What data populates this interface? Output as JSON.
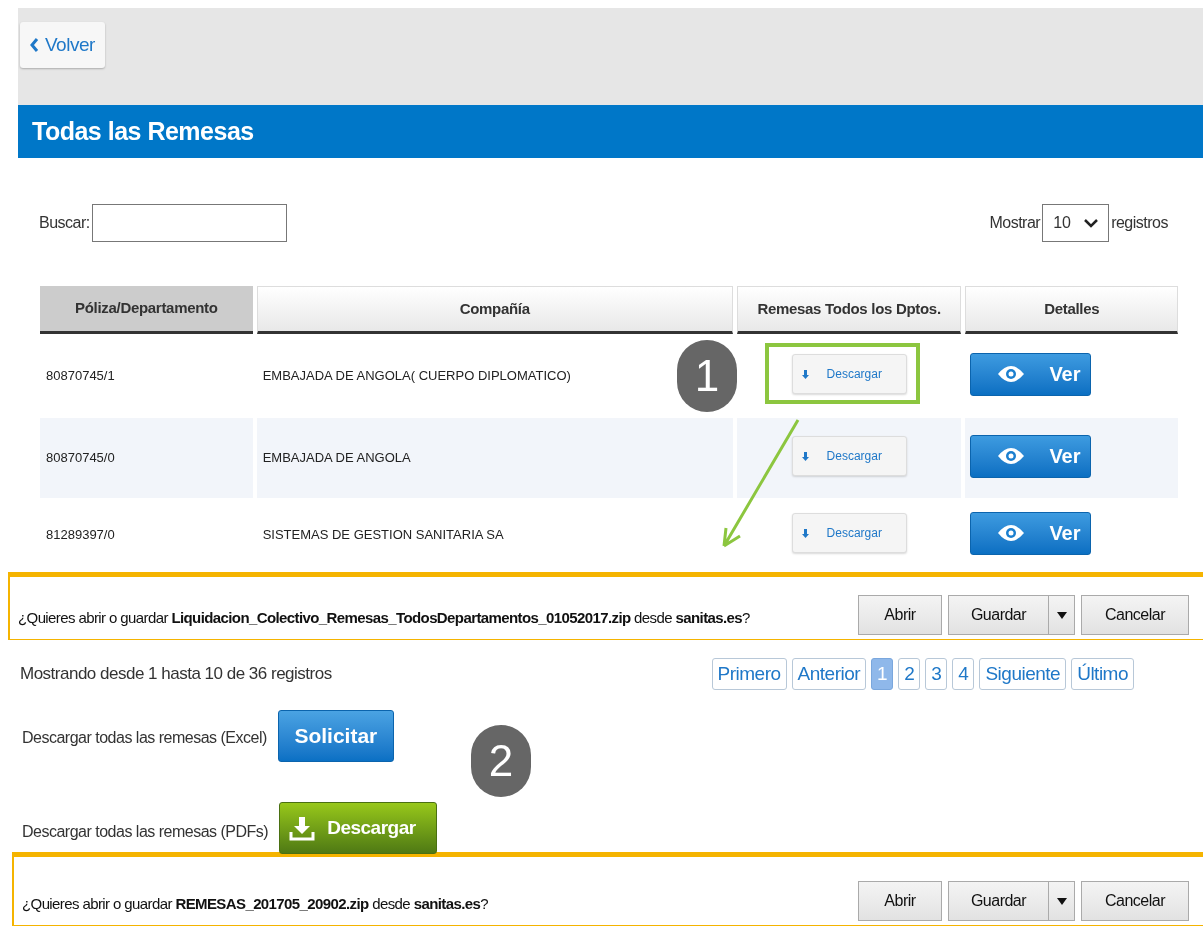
{
  "back_button": {
    "label": "Volver"
  },
  "header": {
    "title": "Todas las Remesas"
  },
  "search": {
    "label": "Buscar:"
  },
  "page_size": {
    "prefix": "Mostrar",
    "value": "10",
    "suffix": "registros"
  },
  "table": {
    "columns": [
      {
        "label": "Póliza/Departamento",
        "sorted": true
      },
      {
        "label": "Compañía",
        "sorted": false
      },
      {
        "label": "Remesas Todos los Dptos.",
        "sorted": false
      },
      {
        "label": "Detalles",
        "sorted": false
      }
    ],
    "rows": [
      {
        "policy": "80870745/1",
        "company": "EMBAJADA DE ANGOLA( CUERPO DIPLOMATICO)",
        "download": "Descargar",
        "details": "Ver"
      },
      {
        "policy": "80870745/0",
        "company": "EMBAJADA DE ANGOLA",
        "download": "Descargar",
        "details": "Ver"
      },
      {
        "policy": "81289397/0",
        "company": "SISTEMAS DE GESTION SANITARIA SA",
        "download": "Descargar",
        "details": "Ver"
      }
    ]
  },
  "download_bars": [
    {
      "prompt": "¿Quieres abrir o guardar **Liquidacion_Colectivo_Remesas_TodosDepartamentos_01052017.zip** desde **sanitas.es**?",
      "open": "Abrir",
      "save": "Guardar",
      "cancel": "Cancelar"
    },
    {
      "prompt": "¿Quieres abrir o guardar **REMESAS_201705_20902.zip** desde **sanitas.es**?",
      "open": "Abrir",
      "save": "Guardar",
      "cancel": "Cancelar"
    }
  ],
  "info": "Mostrando desde 1 hasta 10 de 36 registros",
  "pagination": [
    {
      "label": "Primero",
      "selected": false
    },
    {
      "label": "Anterior",
      "selected": false
    },
    {
      "label": "1",
      "selected": true
    },
    {
      "label": "2",
      "selected": false
    },
    {
      "label": "3",
      "selected": false
    },
    {
      "label": "4",
      "selected": false
    },
    {
      "label": "Siguiente",
      "selected": false
    },
    {
      "label": "Último",
      "selected": false
    }
  ],
  "bulk_downloads": [
    {
      "kind": "request",
      "label": "Descargar todas las remesas (Excel)",
      "button": "Solicitar"
    },
    {
      "kind": "download",
      "label": "Descargar todas las remesas (PDFs)",
      "button": "Descargar"
    }
  ],
  "annotations": [
    {
      "label": "1"
    },
    {
      "label": "2"
    }
  ]
}
